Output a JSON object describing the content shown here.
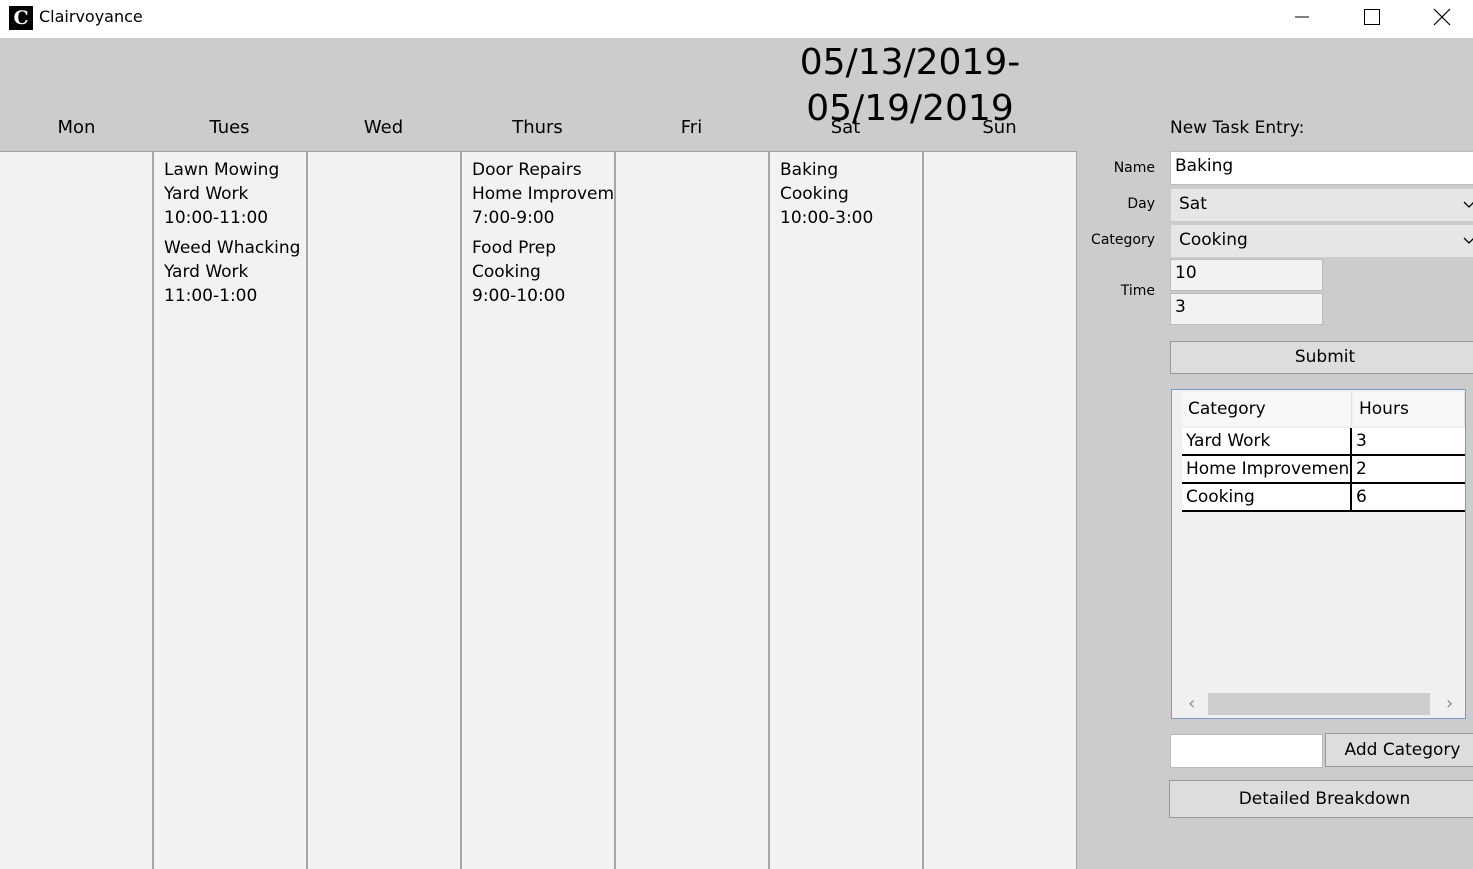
{
  "window": {
    "title": "Clairvoyance",
    "icon_letter": "C"
  },
  "week_range": "05/13/2019-05/19/2019",
  "days": [
    {
      "label": "Mon",
      "tasks": []
    },
    {
      "label": "Tues",
      "tasks": [
        {
          "lines": [
            "Lawn Mowing",
            "Yard Work",
            "10:00-11:00"
          ]
        },
        {
          "lines": [
            "Weed Whacking",
            "Yard Work",
            "11:00-1:00"
          ]
        }
      ]
    },
    {
      "label": "Wed",
      "tasks": []
    },
    {
      "label": "Thurs",
      "tasks": [
        {
          "lines": [
            "Door Repairs",
            "Home Improvem",
            "7:00-9:00"
          ]
        },
        {
          "lines": [
            "Food Prep",
            "Cooking",
            "9:00-10:00"
          ]
        }
      ]
    },
    {
      "label": "Fri",
      "tasks": []
    },
    {
      "label": "Sat",
      "tasks": [
        {
          "lines": [
            "Baking",
            "Cooking",
            "10:00-3:00"
          ]
        }
      ]
    },
    {
      "label": "Sun",
      "tasks": []
    }
  ],
  "form": {
    "title": "New Task Entry:",
    "name_label": "Name",
    "name_value": "Baking",
    "day_label": "Day",
    "day_value": "Sat",
    "category_label": "Category",
    "category_value": "Cooking",
    "time_label": "Time",
    "time_start": "10",
    "time_end": "3",
    "submit_label": "Submit"
  },
  "breakdown": {
    "headers": [
      "Category",
      "Hours"
    ],
    "rows": [
      {
        "category": "Yard Work",
        "hours": "3"
      },
      {
        "category": "Home Improvement",
        "hours": "2"
      },
      {
        "category": "Cooking",
        "hours": "6"
      }
    ]
  },
  "add_category": {
    "input_value": "",
    "button_label": "Add Category"
  },
  "detailed_breakdown_label": "Detailed Breakdown"
}
